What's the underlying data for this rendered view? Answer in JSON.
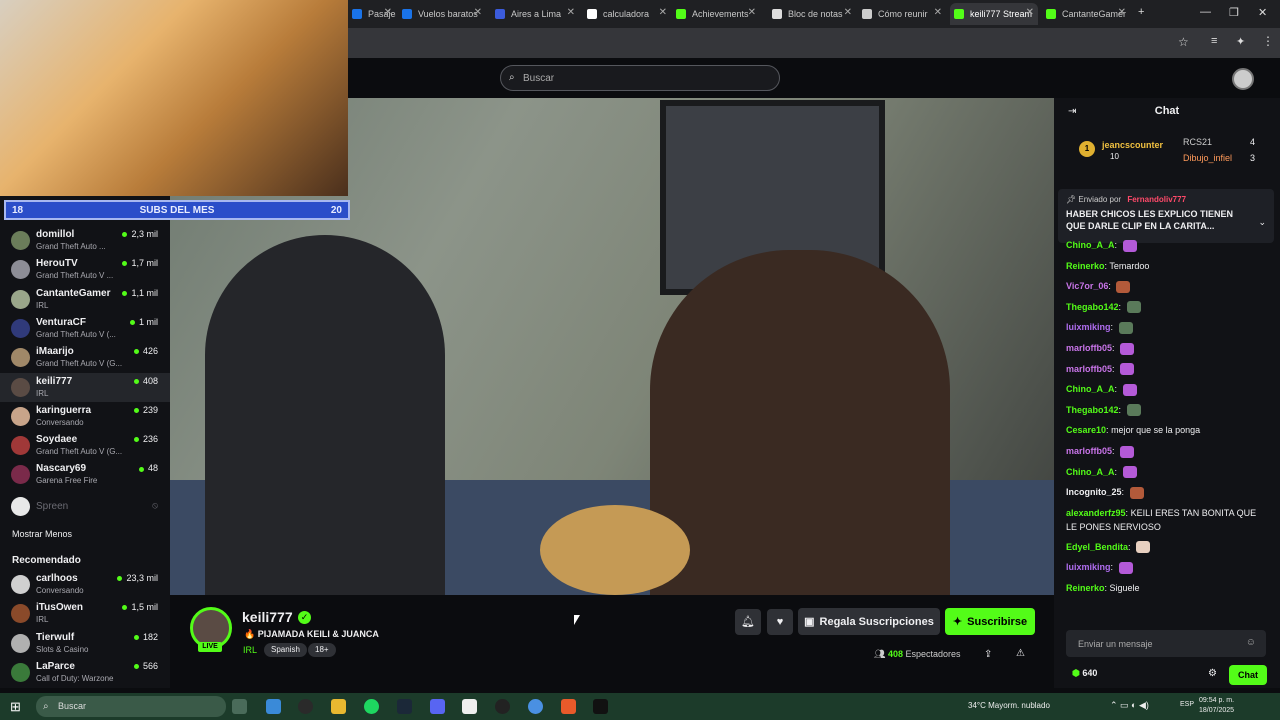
{
  "browser": {
    "tabs": [
      {
        "label": "Pasajes baratos",
        "fav": "#1a73e8"
      },
      {
        "label": "Vuelos baratos",
        "fav": "#1a73e8"
      },
      {
        "label": "Aires a Lima",
        "fav": "#3b5bdb"
      },
      {
        "label": "calculadora",
        "fav": "#ffffff"
      },
      {
        "label": "Achievements",
        "fav": "#53fc18"
      },
      {
        "label": "Bloc de notas",
        "fav": "#dddddd"
      },
      {
        "label": "Cómo reunir",
        "fav": "#cccccc"
      },
      {
        "label": "keili777 Stream",
        "fav": "#53fc18"
      },
      {
        "label": "CantanteGamer",
        "fav": "#53fc18"
      }
    ],
    "new_tab": "+"
  },
  "header": {
    "search_placeholder": "Buscar"
  },
  "overlay": {
    "subs_current": "18",
    "subs_label": "SUBS DEL MES",
    "subs_goal": "20"
  },
  "sidebar": {
    "following": [
      {
        "name": "domillol",
        "category": "Grand Theft Auto ...",
        "viewers": "2,3 mil",
        "color": "#6b7d5a"
      },
      {
        "name": "HerouTV",
        "category": "Grand Theft Auto V ...",
        "viewers": "1,7 mil",
        "color": "#8d8d96"
      },
      {
        "name": "CantanteGamer",
        "category": "IRL",
        "viewers": "1,1 mil",
        "color": "#9aa68a"
      },
      {
        "name": "VenturaCF",
        "category": "Grand Theft Auto V (...",
        "viewers": "1 mil",
        "color": "#303a7a"
      },
      {
        "name": "iMaarijo",
        "category": "Grand Theft Auto V (G...",
        "viewers": "426",
        "color": "#a08868"
      },
      {
        "name": "keili777",
        "category": "IRL",
        "viewers": "408",
        "color": "#5a4b44"
      },
      {
        "name": "karinguerra",
        "category": "Conversando",
        "viewers": "239",
        "color": "#c8a48a"
      },
      {
        "name": "Soydaee",
        "category": "Grand Theft Auto V (G...",
        "viewers": "236",
        "color": "#a03838"
      },
      {
        "name": "Nascary69",
        "category": "Garena Free Fire",
        "viewers": "48",
        "color": "#7a2a4a"
      }
    ],
    "offline": {
      "name": "Spreen"
    },
    "show_less": "Mostrar Menos",
    "recommended_title": "Recomendado",
    "recommended": [
      {
        "name": "carlhoos",
        "category": "Conversando",
        "viewers": "23,3 mil",
        "color": "#d0d0d0"
      },
      {
        "name": "iTusOwen",
        "category": "IRL",
        "viewers": "1,5 mil",
        "color": "#8a4a2a"
      },
      {
        "name": "Tierwulf",
        "category": "Slots & Casino",
        "viewers": "182",
        "color": "#b0b0b0"
      },
      {
        "name": "LaParce",
        "category": "Call of Duty: Warzone",
        "viewers": "566",
        "color": "#3a7a3a"
      }
    ]
  },
  "stream": {
    "channel": "keili777",
    "title": "🔥 PIJAMADA KEILI & JUANCA",
    "category": "IRL",
    "tags": [
      "Spanish",
      "18+"
    ],
    "live": "LIVE",
    "viewers": "408",
    "viewers_label": "Espectadores",
    "gift_label": "Regala Suscripciones",
    "subscribe_label": "Suscribirse"
  },
  "chat": {
    "title": "Chat",
    "leaderboard": [
      {
        "rank": "1",
        "name": "jeancscounter",
        "value": "10"
      },
      {
        "name": "RCS21",
        "value": "4"
      },
      {
        "name": "Dibujo_infiel",
        "value": "3"
      }
    ],
    "pinned_by": "Enviado por",
    "pinned_user": "Fernandoliv777",
    "pinned_text": "HABER CHICOS LES EXPLICO TIENEN QUE DARLE CLIP EN LA CARITA...",
    "messages": [
      {
        "user": "Chino_A_A",
        "text": "",
        "color": "#53fc18",
        "emote": "#b45ad8"
      },
      {
        "user": "Reinerko",
        "text": "Temardoo",
        "color": "#53fc18"
      },
      {
        "user": "Vic7or_06",
        "text": "",
        "color": "#c874e8",
        "emote": "#b35a3a"
      },
      {
        "user": "Thegabo142",
        "text": "",
        "color": "#53fc18",
        "emote": "#5a7a5a"
      },
      {
        "user": "luixmiking",
        "text": "",
        "color": "#b06df0",
        "emote": "#5a7a5a"
      },
      {
        "user": "marloffb05",
        "text": "",
        "color": "#c874e8",
        "emote": "#b45ad8"
      },
      {
        "user": "marloffb05",
        "text": "",
        "color": "#c874e8",
        "emote": "#b45ad8"
      },
      {
        "user": "Chino_A_A",
        "text": "",
        "color": "#53fc18",
        "emote": "#b45ad8"
      },
      {
        "user": "Thegabo142",
        "text": "",
        "color": "#53fc18",
        "emote": "#5a7a5a"
      },
      {
        "user": "Cesare10",
        "text": "mejor que se la ponga",
        "color": "#53fc18"
      },
      {
        "user": "marloffb05",
        "text": "",
        "color": "#c874e8",
        "emote": "#b45ad8"
      },
      {
        "user": "Chino_A_A",
        "text": "",
        "color": "#53fc18",
        "emote": "#b45ad8"
      },
      {
        "user": "Incognito_25",
        "text": "",
        "color": "#efeff1",
        "emote": "#b35a3a"
      },
      {
        "user": "alexanderfz95",
        "text": "KEILI ERES TAN BONITA QUE LE PONES NERVIOSO",
        "color": "#53fc18"
      },
      {
        "user": "Edyel_Bendita",
        "text": "",
        "color": "#53fc18",
        "emote": "#e8d0c0"
      },
      {
        "user": "luixmiking",
        "text": "",
        "color": "#b06df0",
        "emote": "#b45ad8"
      },
      {
        "user": "Reinerko",
        "text": "Siguele",
        "color": "#53fc18"
      }
    ],
    "input_placeholder": "Enviar un mensaje",
    "points": "640",
    "send_label": "Chat"
  },
  "taskbar": {
    "search": "Buscar",
    "weather": "34°C  Mayorm. nublado",
    "lang": "ESP",
    "time": "09:54 p. m.",
    "date": "18/07/2025"
  }
}
